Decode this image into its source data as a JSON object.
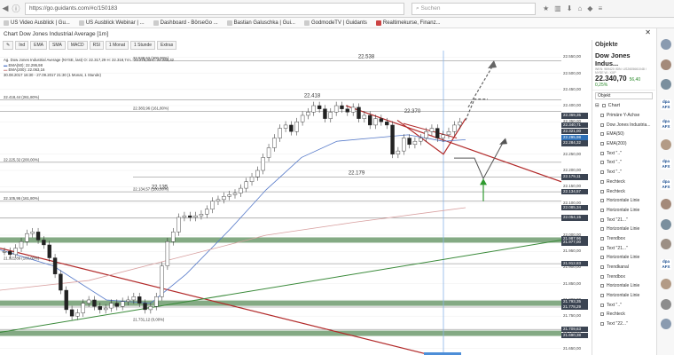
{
  "browser": {
    "url": "https://go.guidants.com/#c/150183",
    "search_placeholder": "Suchen"
  },
  "bookmarks": [
    "US Video Ausblick | Gu...",
    "US Ausblick Webinar | ...",
    "Dashboard - BörseGo ...",
    "Bastian Galuschka | Gui...",
    "GodmodeTV | Guidants",
    "Realtimekurse, Finanz..."
  ],
  "window": {
    "title": "Chart Dow Jones Industrial Average [1m]",
    "close": "✕"
  },
  "toolbar": [
    "Ind",
    "EMA",
    "SMA",
    "MACD",
    "RSI",
    "1 Monat",
    "1 Stunde",
    "Extras"
  ],
  "legend": [
    "Ag. Dow Jones Industrial Average (NYSE, last)  O: 22.317,29  H: 22.318,74  L: 22.279,33  C: 22.284,32",
    "EMA(50): 22.295,98",
    "EMA(200): 22.063,16",
    "30.08.2017 16:30 - 27.09.2017 21:30   (1 Monat, 1 Stunde)"
  ],
  "annotations": [
    {
      "text": "22.538",
      "price": 22538
    },
    {
      "text": "22.418",
      "price": 22418
    },
    {
      "text": "22.370",
      "price": 22370
    },
    {
      "text": "22.179",
      "price": 22179
    },
    {
      "text": "22.135",
      "price": 22135
    }
  ],
  "fib_labels": [
    {
      "text": "22.538,62 (200,00%)",
      "price": 22538
    },
    {
      "text": "22.418,44 (261,80%)",
      "price": 22418
    },
    {
      "text": "22.383,96 (161,80%)",
      "price": 22383
    },
    {
      "text": "22.225,32 (200,00%)",
      "price": 22225
    },
    {
      "text": "22.134,57 (100,00%)",
      "price": 22134
    },
    {
      "text": "22.105,95 (161,80%)",
      "price": 22105
    },
    {
      "text": "21.921,89 (100,00%)",
      "price": 21921
    },
    {
      "text": "21.731,12 (0,00%)",
      "price": 21731
    }
  ],
  "axis_ticks": [
    "22.550,00",
    "22.500,00",
    "22.450,00",
    "22.400,00",
    "22.350,00",
    "22.300,00",
    "22.250,00",
    "22.200,00",
    "22.150,00",
    "22.100,00",
    "22.050,00",
    "22.000,00",
    "21.950,00",
    "21.900,00",
    "21.850,00",
    "21.800,00",
    "21.750,00",
    "21.700,00",
    "21.650,00"
  ],
  "axis_tick_prices": [
    22550,
    22500,
    22450,
    22400,
    22350,
    22300,
    22250,
    22200,
    22150,
    22100,
    22050,
    22000,
    21950,
    21900,
    21850,
    21800,
    21750,
    21700,
    21650
  ],
  "price_tags": [
    {
      "text": "22.369,35",
      "price": 22369,
      "color": "#3b4452"
    },
    {
      "text": "22.340,71",
      "price": 22340,
      "color": "#3b4452"
    },
    {
      "text": "22.321,00",
      "price": 22321,
      "color": "#3b4452"
    },
    {
      "text": "22.295,98",
      "price": 22300,
      "color": "#2c6fb6"
    },
    {
      "text": "22.284,32",
      "price": 22284,
      "color": "#3b4452"
    },
    {
      "text": "22.179,11",
      "price": 22179,
      "color": "#3b4452"
    },
    {
      "text": "22.134,57",
      "price": 22134,
      "color": "#3b4452"
    },
    {
      "text": "22.085,34",
      "price": 22085,
      "color": "#3b4452"
    },
    {
      "text": "22.054,15",
      "price": 22054,
      "color": "#3b4452"
    },
    {
      "text": "21.987,96",
      "price": 21987,
      "color": "#3b4452"
    },
    {
      "text": "21.977,00",
      "price": 21977,
      "color": "#3b4452"
    },
    {
      "text": "21.912,83",
      "price": 21912,
      "color": "#3b4452"
    },
    {
      "text": "21.793,35",
      "price": 21793,
      "color": "#3b4452"
    },
    {
      "text": "21.778,29",
      "price": 21778,
      "color": "#3b4452"
    },
    {
      "text": "21.709,63",
      "price": 21709,
      "color": "#3b4452"
    },
    {
      "text": "21.690,38",
      "price": 21690,
      "color": "#3b4452"
    }
  ],
  "objects_panel": {
    "title": "Objekte",
    "quote_name": "Dow Jones Indus...",
    "quote_meta": "WKN: 969420 ISIN: US2605661048 / NYSE  W.: XXP",
    "quote_price": "22.340,70",
    "quote_change": "56,40  0,25%",
    "select": "Objekt",
    "root": "Chart",
    "items": [
      "Primäre Y-Achse",
      "Dow Jones Industria...",
      "EMA(50)",
      "EMA(200)",
      "Text \"..\"",
      "Text \"..\"",
      "Text \"..\"",
      "Rechteck",
      "Rechteck",
      "Horizontale Linie",
      "Horizontale Linie",
      "Text \"21...\"",
      "Horizontale Linie",
      "Trendbox",
      "Text \"21...\"",
      "Horizontale Linie",
      "Trendkanal",
      "Trendbox",
      "Horizontale Linie",
      "Horizontale Linie",
      "Text \"..\"",
      "Rechteck",
      "Text \"22...\""
    ]
  },
  "avatars": [
    "user",
    "user",
    "user",
    "dpa AFX",
    "dpa AFX",
    "user",
    "dpa AFX",
    "dpa AFX",
    "user",
    "user",
    "user",
    "dpa AFX",
    "user",
    "user",
    "user"
  ],
  "colors": {
    "horizontal_band": "#6e9b6e",
    "trend_red": "#b22a2a",
    "trend_green": "#3a8a3a",
    "ema50": "#5579c9",
    "ema200": "#d8a0a0",
    "arrow_green": "#2f9a2f"
  }
}
